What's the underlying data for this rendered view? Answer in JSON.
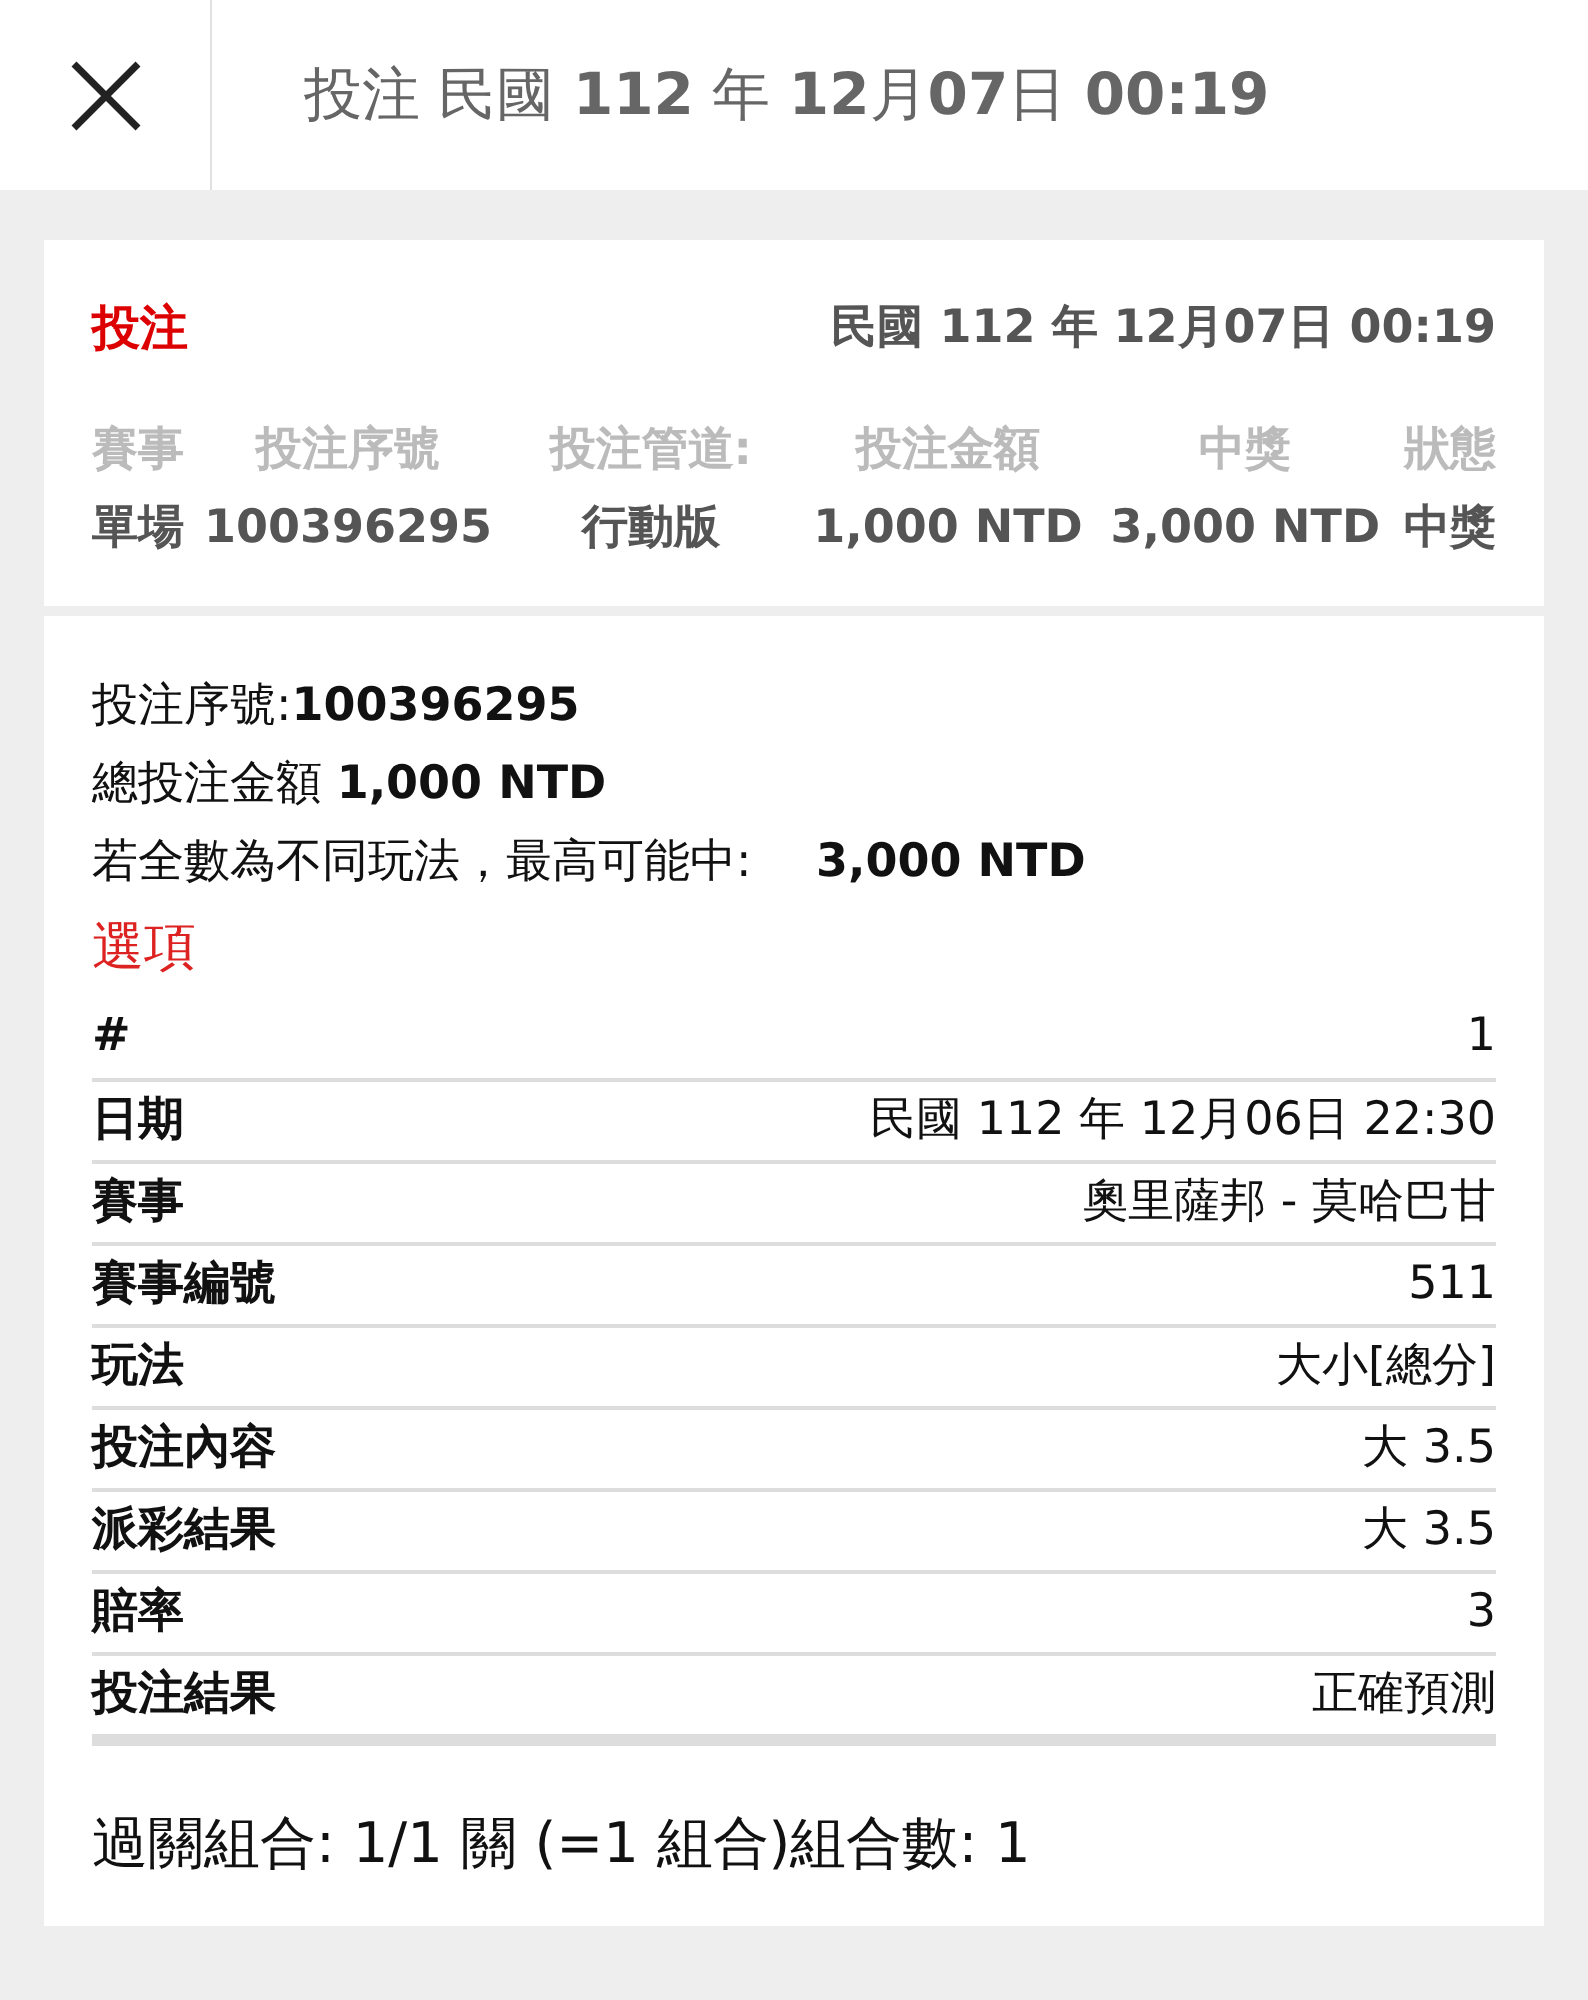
{
  "header": {
    "title": "投注 民國 **112** 年 **12**月**07**日 **00:19**"
  },
  "summary": {
    "title": "投注",
    "date": "民國 112 年 12月07日 00:19",
    "columns": [
      "賽事",
      "投注序號",
      "投注管道:",
      "投注金額",
      "中獎",
      "狀態"
    ],
    "values": [
      "單場",
      "100396295",
      "行動版",
      "1,000 NTD",
      "3,000 NTD",
      "中獎"
    ]
  },
  "details": {
    "lines": [
      "投注序號:**100396295**",
      "總投注金額 **1,000 NTD**"
    ],
    "max_win": {
      "label": "若全數為不同玩法，最高可能中:",
      "value": "3,000 NTD"
    },
    "section_title": "選項",
    "rows": [
      {
        "label": "#",
        "value": "1"
      },
      {
        "label": "日期",
        "value": "民國 112 年 12月06日 22:30"
      },
      {
        "label": "賽事",
        "value": "奧里薩邦 - 莫哈巴甘"
      },
      {
        "label": "賽事編號",
        "value": "511"
      },
      {
        "label": "玩法",
        "value": "大小[總分]"
      },
      {
        "label": "投注內容",
        "value": "大 3.5"
      },
      {
        "label": "派彩結果",
        "value": "大 3.5"
      },
      {
        "label": "賠率",
        "value": "3"
      },
      {
        "label": "投注結果",
        "value": "正確預測"
      }
    ],
    "footer": "過關組合: 1/1 關 (=1 組合)組合數: 1"
  }
}
